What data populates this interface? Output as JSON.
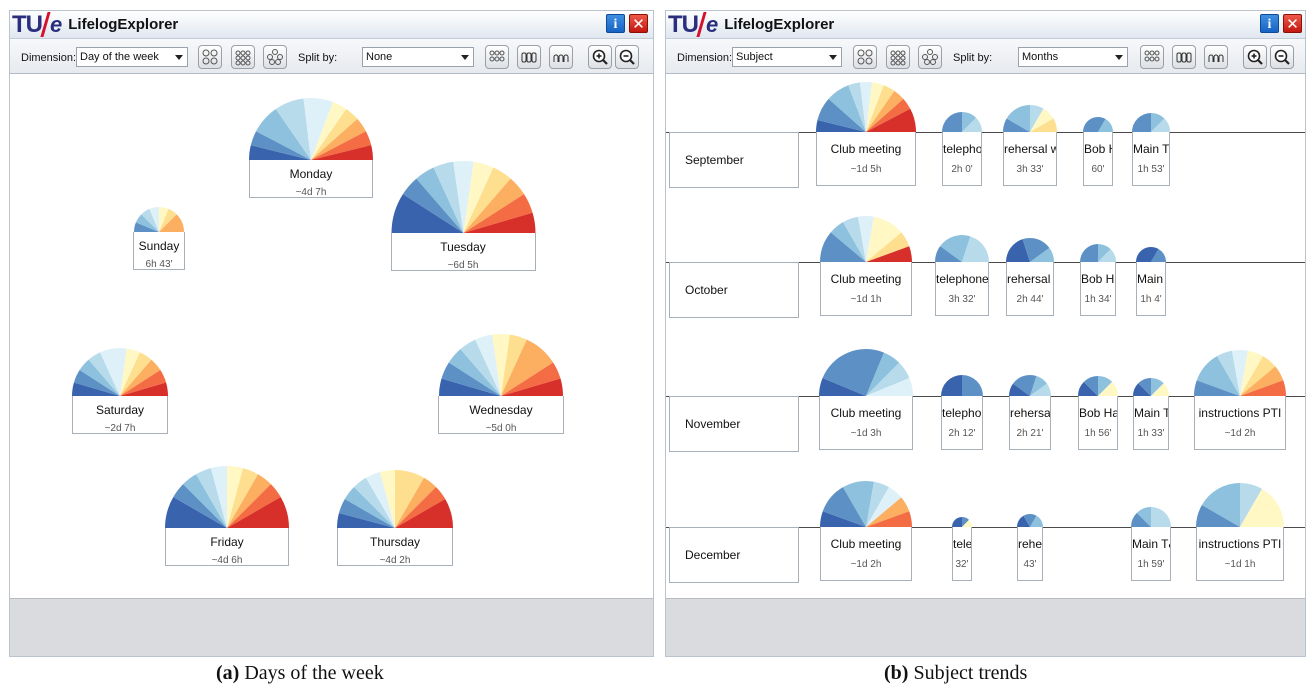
{
  "palette": [
    "#3a63ad",
    "#5d91c6",
    "#8dc1dd",
    "#b8dbec",
    "#dff1f8",
    "#fff8c4",
    "#fedf8f",
    "#fcaf61",
    "#f46c43",
    "#d7302a"
  ],
  "window_a": {
    "title": "LifelogExplorer",
    "dimension_label": "Dimension:",
    "dimension_value": "Day of the week",
    "split_label": "Split by:",
    "split_value": "None",
    "glyphs": [
      {
        "name": "Monday",
        "duration": "~4d 7h",
        "weights": [
          1,
          1,
          2,
          2,
          2,
          1,
          1,
          1,
          1,
          1
        ]
      },
      {
        "name": "Tuesday",
        "duration": "~6d 5h",
        "weights": [
          2,
          1,
          1,
          1,
          1,
          1,
          1,
          1,
          1,
          1
        ]
      },
      {
        "name": "Sunday",
        "duration": "6h 43'",
        "weights": [
          0,
          1,
          1,
          1,
          1,
          1,
          1,
          2,
          0,
          0
        ]
      },
      {
        "name": "Saturday",
        "duration": "~2d 7h",
        "weights": [
          1,
          1,
          1,
          1,
          2,
          1,
          1,
          1,
          1,
          1
        ]
      },
      {
        "name": "Wednesday",
        "duration": "~5d 0h",
        "weights": [
          1,
          1,
          1,
          1,
          1,
          1,
          1,
          2,
          1,
          1
        ]
      },
      {
        "name": "Friday",
        "duration": "~4d 6h",
        "weights": [
          2,
          1,
          1,
          1,
          1,
          1,
          1,
          1,
          1,
          2
        ]
      },
      {
        "name": "Thursday",
        "duration": "~4d 2h",
        "weights": [
          1,
          1,
          1,
          1,
          1,
          1,
          2,
          1,
          1,
          2
        ]
      }
    ]
  },
  "window_b": {
    "title": "LifelogExplorer",
    "dimension_label": "Dimension:",
    "dimension_value": "Subject",
    "split_label": "Split by:",
    "split_value": "Months",
    "months": [
      {
        "label": "September",
        "glyphs": [
          {
            "name": "Club meeting",
            "duration": "~1d 5h",
            "weights": [
              1,
              2,
              2,
              1,
              1,
              1,
              1,
              1,
              1,
              2
            ]
          },
          {
            "name": "telephone ...",
            "duration": "2h 0'",
            "weights": [
              0,
              2,
              1,
              1,
              0,
              0,
              0,
              0,
              0,
              0
            ]
          },
          {
            "name": "rehersal with ...",
            "duration": "3h 33'",
            "weights": [
              0,
              1,
              2,
              1,
              0,
              1,
              1,
              0,
              0,
              0
            ]
          },
          {
            "name": "Bob Ha...",
            "duration": "60'",
            "weights": [
              0,
              2,
              1,
              0,
              0,
              0,
              0,
              0,
              0,
              0
            ]
          },
          {
            "name": "Main T&K",
            "duration": "1h 53'",
            "weights": [
              0,
              2,
              1,
              1,
              0,
              0,
              0,
              0,
              0,
              0
            ]
          }
        ]
      },
      {
        "label": "October",
        "glyphs": [
          {
            "name": "Club meeting",
            "duration": "~1d 1h",
            "weights": [
              0,
              2,
              1,
              1,
              1,
              2,
              1,
              0,
              0,
              1
            ]
          },
          {
            "name": "telephone conv...",
            "duration": "3h 32'",
            "weights": [
              0,
              1,
              2,
              2,
              0,
              0,
              0,
              0,
              0,
              0
            ]
          },
          {
            "name": "rehersal wit...",
            "duration": "2h 44'",
            "weights": [
              2,
              2,
              1,
              0,
              0,
              0,
              0,
              0,
              0,
              0
            ]
          },
          {
            "name": "Bob Hakel",
            "duration": "1h 34'",
            "weights": [
              0,
              2,
              1,
              1,
              0,
              0,
              0,
              0,
              0,
              0
            ]
          },
          {
            "name": "Main T&K",
            "duration": "1h 4'",
            "weights": [
              2,
              1,
              0,
              0,
              0,
              0,
              0,
              0,
              0,
              0
            ]
          }
        ]
      },
      {
        "label": "November",
        "glyphs": [
          {
            "name": "Club meeting",
            "duration": "~1d 3h",
            "weights": [
              1,
              4,
              1,
              1,
              1,
              0,
              0,
              0,
              0,
              0
            ]
          },
          {
            "name": "telephone ...",
            "duration": "2h 12'",
            "weights": [
              2,
              2,
              0,
              0,
              0,
              0,
              0,
              0,
              0,
              0
            ]
          },
          {
            "name": "rehersal wi...",
            "duration": "2h 21'",
            "weights": [
              1,
              2,
              1,
              1,
              0,
              0,
              0,
              0,
              0,
              0
            ]
          },
          {
            "name": "Bob Hakel",
            "duration": "1h 56'",
            "weights": [
              1,
              1,
              1,
              0,
              0,
              1,
              0,
              0,
              0,
              0
            ]
          },
          {
            "name": "Main T&K",
            "duration": "1h 33'",
            "weights": [
              1,
              1,
              1,
              0,
              0,
              1,
              0,
              0,
              0,
              0
            ]
          },
          {
            "name": "instructions PTI",
            "duration": "~1d 2h",
            "weights": [
              0,
              1,
              2,
              1,
              1,
              1,
              1,
              1,
              1,
              0
            ]
          }
        ]
      },
      {
        "label": "December",
        "glyphs": [
          {
            "name": "Club meeting",
            "duration": "~1d 2h",
            "weights": [
              1,
              2,
              2,
              1,
              1,
              0,
              0,
              1,
              1,
              0
            ]
          },
          {
            "name": "tele...",
            "duration": "32'",
            "weights": [
              2,
              1,
              0,
              0,
              0,
              1,
              0,
              0,
              0,
              0
            ]
          },
          {
            "name": "reher...",
            "duration": "43'",
            "weights": [
              1,
              1,
              1,
              0,
              0,
              0,
              0,
              0,
              0,
              0
            ]
          },
          {
            "name": "Main T&K",
            "duration": "1h 59'",
            "weights": [
              0,
              1,
              1,
              2,
              0,
              0,
              0,
              0,
              0,
              0
            ]
          },
          {
            "name": "instructions PTI",
            "duration": "~1d 1h",
            "weights": [
              0,
              1,
              2,
              1,
              0,
              2,
              0,
              0,
              0,
              0
            ]
          }
        ]
      }
    ]
  },
  "captions": {
    "a_label": "(a)",
    "a_text": "Days of the week",
    "b_label": "(b)",
    "b_text": "Subject trends"
  }
}
